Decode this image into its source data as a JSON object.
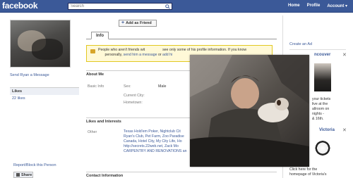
{
  "header": {
    "logo": "facebook",
    "search_placeholder": "Search",
    "nav": [
      "Home",
      "Profile",
      "Account"
    ]
  },
  "left": {
    "send_message": "Send Ryan a Message",
    "likes_header": "Likes",
    "likes_count": "22 likes",
    "report": "Report/Block this Person",
    "share": "Share"
  },
  "center": {
    "add_friend": "Add as Friend",
    "tab_info": "Info",
    "notice_line1": "People who aren't friends wit",
    "notice_line1b": "see only some of his profile information. If you know",
    "notice_line2a": "personally,",
    "notice_send": "send him a message",
    "notice_or": "or",
    "notice_add": "add hi",
    "about_head": "About Me",
    "basic_info_label": "Basic Info",
    "sex_label": "Sex:",
    "sex_value": "Male",
    "current_city_label": "Current City:",
    "hometown_label": "Hometown:",
    "likes_interests_head": "Likes and Interests",
    "other_label": "Other",
    "interests_lines": [
      "Texas Hold'em Poker, Nightclub Cit",
      "Ryan's Club, Pet Farm, Zoo Paradise",
      "Canada, Hotel City, My City Life, Ho",
      "http://secrets.22web.net, Zack Mo",
      "CARPENTRY AND RENOVATIONS an"
    ],
    "contact_head": "Contact Information"
  },
  "right": {
    "create_ad": "Create an Ad",
    "ad1_title": "ncouver",
    "ad1_lines": [
      "your tickets",
      "live at the",
      "allroom on",
      "nights -",
      "& 16th."
    ],
    "ad2_title": "Victoria",
    "ad2_lines": [
      "Click here for the",
      "homepage of Victoria's"
    ]
  },
  "icons": {
    "search": "search-icon",
    "plus": "plus-icon",
    "lock": "lock-icon",
    "close": "close-icon",
    "share": "share-icon"
  },
  "colors": {
    "brand": "#3b5998",
    "link": "#3b5998",
    "notice_bg": "#fff9d7",
    "notice_border": "#e2c822"
  }
}
